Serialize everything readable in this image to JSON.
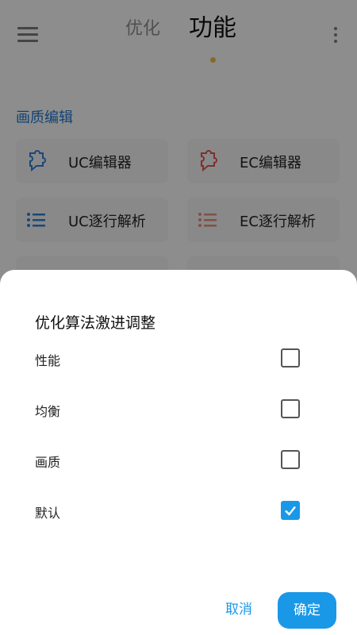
{
  "header": {
    "tab_optimize": "优化",
    "tab_function": "功能",
    "menu_icon": "hamburger-menu-icon",
    "more_icon": "vertical-dots-icon"
  },
  "section": {
    "title": "画质编辑",
    "tiles": [
      {
        "label": "UC编辑器",
        "icon": "puzzle-edit-icon",
        "color": "#2f7ad6"
      },
      {
        "label": "EC编辑器",
        "icon": "puzzle-edit-icon",
        "color": "#d9534f"
      },
      {
        "label": "UC逐行解析",
        "icon": "list-icon",
        "color": "#2f7ad6"
      },
      {
        "label": "EC逐行解析",
        "icon": "list-icon",
        "color": "#e08a7a"
      }
    ]
  },
  "dialog": {
    "title": "优化算法激进调整",
    "options": [
      {
        "label": "性能",
        "checked": false
      },
      {
        "label": "均衡",
        "checked": false
      },
      {
        "label": "画质",
        "checked": false
      },
      {
        "label": "默认",
        "checked": true
      }
    ],
    "cancel_label": "取消",
    "ok_label": "确定",
    "accent_color": "#1a98e8"
  }
}
